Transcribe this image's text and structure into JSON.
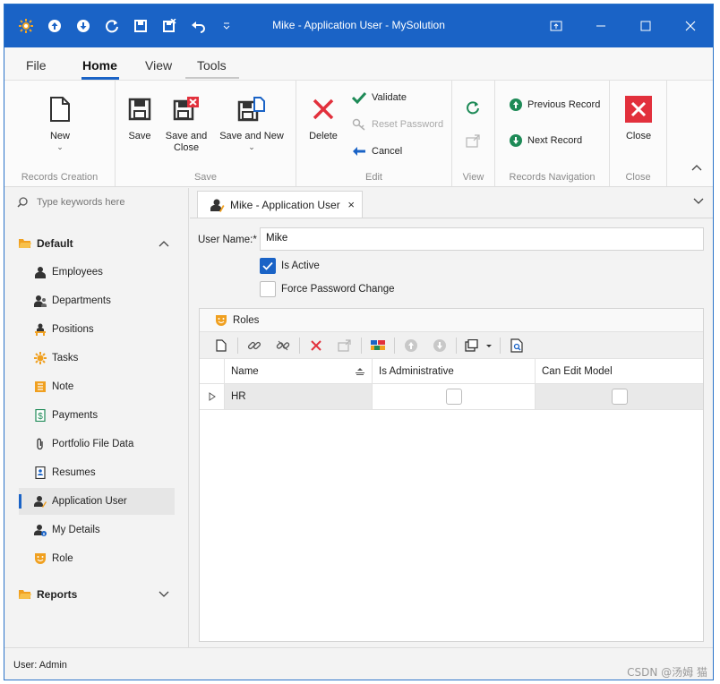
{
  "window": {
    "title": "Mike - Application User - MySolution"
  },
  "ribbon": {
    "tabs": [
      {
        "label": "File"
      },
      {
        "label": "Home"
      },
      {
        "label": "View"
      },
      {
        "label": "Tools"
      }
    ],
    "groups": {
      "records_creation": {
        "label": "Records Creation",
        "new": "New"
      },
      "save": {
        "label": "Save",
        "save": "Save",
        "save_close_1": "Save and",
        "save_close_2": "Close",
        "save_new": "Save and New"
      },
      "edit": {
        "label": "Edit",
        "delete": "Delete",
        "validate": "Validate",
        "reset_password": "Reset Password",
        "cancel": "Cancel"
      },
      "view": {
        "label": "View"
      },
      "navigation": {
        "label": "Records Navigation",
        "previous": "Previous Record",
        "next": "Next Record"
      },
      "close": {
        "label": "Close",
        "close": "Close"
      }
    }
  },
  "sidebar": {
    "search_placeholder": "Type keywords here",
    "groups": [
      {
        "label": "Default"
      },
      {
        "label": "Reports"
      }
    ],
    "items": [
      {
        "label": "Employees",
        "icon": "employee-icon"
      },
      {
        "label": "Departments",
        "icon": "department-icon"
      },
      {
        "label": "Positions",
        "icon": "position-icon"
      },
      {
        "label": "Tasks",
        "icon": "task-icon"
      },
      {
        "label": "Note",
        "icon": "note-icon"
      },
      {
        "label": "Payments",
        "icon": "payment-icon"
      },
      {
        "label": "Portfolio File Data",
        "icon": "paperclip-icon"
      },
      {
        "label": "Resumes",
        "icon": "resume-icon"
      },
      {
        "label": "Application User",
        "icon": "application-user-icon",
        "active": true
      },
      {
        "label": "My Details",
        "icon": "my-details-icon"
      },
      {
        "label": "Role",
        "icon": "role-icon"
      }
    ]
  },
  "document": {
    "tab_title": "Mike - Application User",
    "user_name_label": "User Name:*",
    "user_name_value": "Mike",
    "is_active_label": "Is Active",
    "is_active": true,
    "force_password_change_label": "Force Password Change",
    "force_password_change": false,
    "roles": {
      "title": "Roles",
      "columns": [
        "Name",
        "Is Administrative",
        "Can Edit Model"
      ],
      "rows": [
        {
          "name": "HR",
          "is_administrative": false,
          "can_edit_model": false
        }
      ]
    }
  },
  "status": {
    "user": "User: Admin"
  },
  "watermark": "CSDN @汤姆 猫",
  "colors": {
    "accent": "#1a63c6",
    "delete_red": "#e2303c",
    "validate_green": "#1e8a57",
    "orange": "#f0a020"
  }
}
